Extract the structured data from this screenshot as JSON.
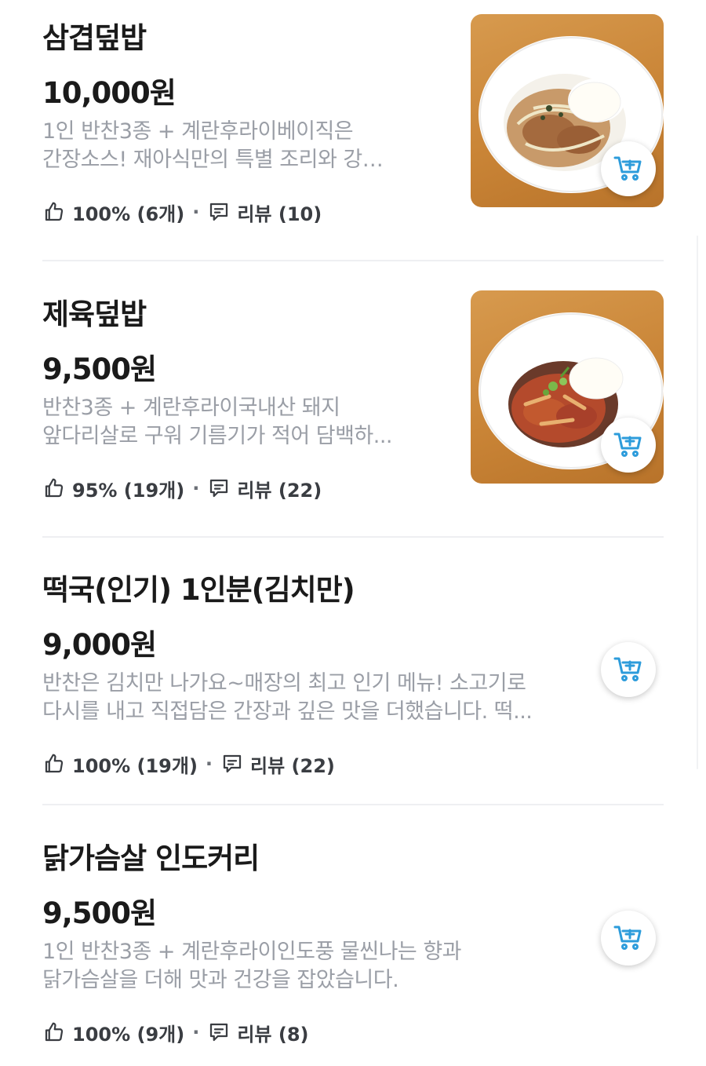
{
  "menu_items": [
    {
      "name": "삼겹덮밥",
      "price": "10,000원",
      "desc_line1": "1인 반찬3종 + 계란후라이베이직은",
      "desc_line2": "간장소스! 재아식만의 특별 조리와 강…",
      "rating": "100% (6개)",
      "reviews": "리뷰 (10)",
      "has_image": true
    },
    {
      "name": "제육덮밥",
      "price": "9,500원",
      "desc_line1": "반찬3종 + 계란후라이국내산 돼지",
      "desc_line2": "앞다리살로 구워 기름기가 적어 담백하...",
      "rating": "95% (19개)",
      "reviews": "리뷰 (22)",
      "has_image": true
    },
    {
      "name": "떡국(인기) 1인분(김치만)",
      "price": "9,000원",
      "desc_line1": "반찬은 김치만 나가요~매장의 최고 인기 메뉴! 소고기로",
      "desc_line2": "다시를 내고 직접담은 간장과 깊은 맛을 더했습니다. 떡...",
      "rating": "100% (19개)",
      "reviews": "리뷰 (22)",
      "has_image": false
    },
    {
      "name": "닭가슴살 인도커리",
      "price": "9,500원",
      "desc_line1": "1인 반찬3종 + 계란후라이인도풍 물씬나는 향과",
      "desc_line2": "닭가슴살을 더해 맛과 건강을 잡았습니다.",
      "rating": "100% (9개)",
      "reviews": "리뷰 (8)",
      "has_image": false
    }
  ],
  "separator": "·",
  "icons": {
    "like": "thumbs-up-icon",
    "review": "chat-bubble-icon",
    "cart": "cart-add-icon"
  },
  "colors": {
    "text_primary": "#1a1a1a",
    "text_secondary": "#9a9ea6",
    "accent": "#2d9cdb",
    "divider": "#eeeff2"
  }
}
